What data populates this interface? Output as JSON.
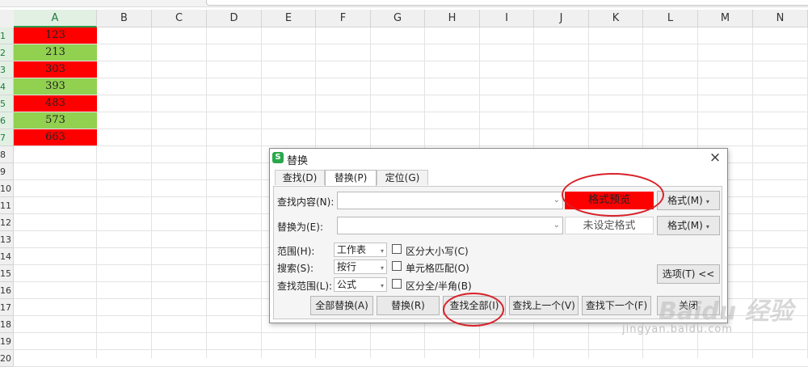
{
  "spreadsheet": {
    "columns": [
      "A",
      "B",
      "C",
      "D",
      "E",
      "F",
      "G",
      "H",
      "I",
      "J",
      "K",
      "L",
      "M",
      "N"
    ],
    "selected_column": "A",
    "rows": [
      "1",
      "2",
      "3",
      "4",
      "5",
      "6",
      "7",
      "8",
      "9",
      "10",
      "11",
      "12",
      "13",
      "14",
      "15",
      "16",
      "17",
      "18",
      "19",
      "20"
    ],
    "cells_a": [
      {
        "value": "123",
        "fill": "red"
      },
      {
        "value": "213",
        "fill": "green"
      },
      {
        "value": "303",
        "fill": "red"
      },
      {
        "value": "393",
        "fill": "green"
      },
      {
        "value": "483",
        "fill": "red"
      },
      {
        "value": "573",
        "fill": "green"
      },
      {
        "value": "663",
        "fill": "red"
      }
    ]
  },
  "colors": {
    "red_fill": "#ff0000",
    "green_fill": "#92d050",
    "annotation": "#d8222a"
  },
  "dialog": {
    "title": "替换",
    "close_icon": "×",
    "tabs": [
      "查找(D)",
      "替换(P)",
      "定位(G)"
    ],
    "active_tab": "替换(P)",
    "find_label": "查找内容(N):",
    "find_value": "",
    "replace_label": "替换为(E):",
    "replace_value": "",
    "find_format_preview": "格式预览",
    "replace_format_preview": "未设定格式",
    "format_button_1": "格式(M)",
    "format_button_2": "格式(M)",
    "scope_label": "范围(H):",
    "scope_value": "工作表",
    "search_label": "搜索(S):",
    "search_value": "按行",
    "lookin_label": "查找范围(L):",
    "lookin_value": "公式",
    "match_case": "区分大小写(C)",
    "match_cell": "单元格匹配(O)",
    "match_width": "区分全/半角(B)",
    "options_button": "选项(T) <<",
    "buttons": {
      "replace_all": "全部替换(A)",
      "replace": "替换(R)",
      "find_all": "查找全部(I)",
      "find_prev": "查找上一个(V)",
      "find_next": "查找下一个(F)",
      "close": "关闭"
    }
  },
  "watermark": {
    "brand": "Baidu 经验",
    "url": "jingyan.baidu.com"
  }
}
